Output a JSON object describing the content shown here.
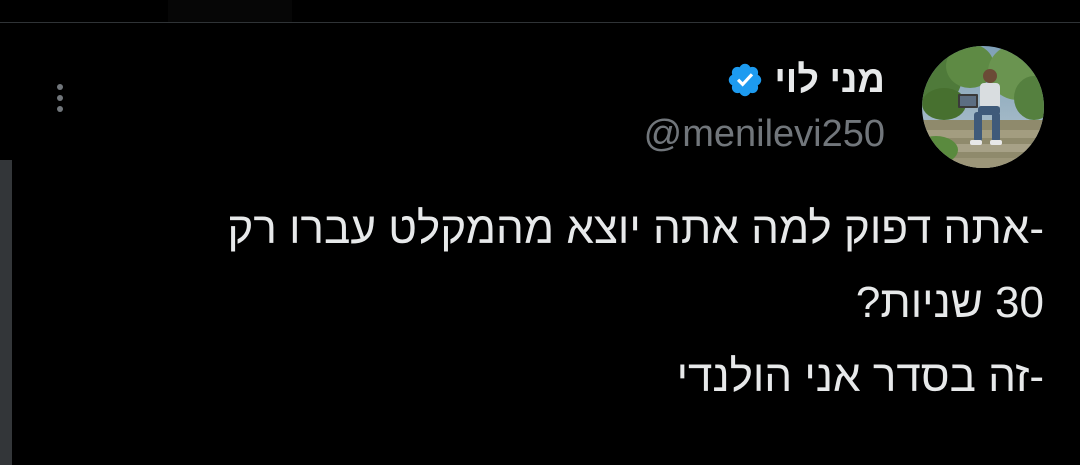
{
  "author": {
    "display_name": "מני לוי",
    "handle": "@menilevi250",
    "verified": true,
    "verified_color": "#1d9bf0"
  },
  "tweet": {
    "lines": [
      "-אתה דפוק למה אתה יוצא מהמקלט עברו רק",
      "30 שניות?",
      "-זה בסדר אני הולנדי"
    ]
  },
  "icons": {
    "more": "more-vertical-icon",
    "verified": "verified-badge-icon"
  },
  "colors": {
    "background": "#000000",
    "text": "#e7e9ea",
    "secondary_text": "#71767b",
    "accent": "#1d9bf0"
  }
}
